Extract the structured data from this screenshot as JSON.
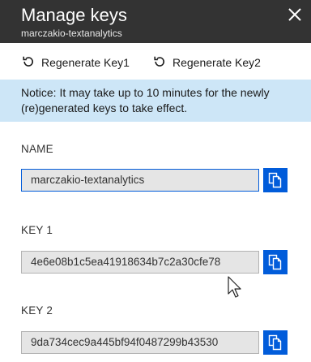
{
  "header": {
    "title": "Manage keys",
    "subtitle": "marczakio-textanalytics"
  },
  "toolbar": {
    "regenerate_key1_label": "Regenerate Key1",
    "regenerate_key2_label": "Regenerate Key2"
  },
  "notice": {
    "text": "Notice: It may take up to 10 minutes for the newly (re)generated keys to take effect."
  },
  "fields": {
    "name": {
      "label": "NAME",
      "value": "marczakio-textanalytics"
    },
    "key1": {
      "label": "KEY 1",
      "value": "4e6e08b1c5ea41918634b7c2a30cfe78"
    },
    "key2": {
      "label": "KEY 2",
      "value": "9da734cec9a445bf94f0487299b43530"
    }
  },
  "icons": {
    "close": "close-icon",
    "regenerate": "refresh-icon",
    "copy": "copy-icon",
    "cursor": "mouse-pointer-icon"
  },
  "colors": {
    "header_bg": "#333333",
    "notice_bg": "#cde6f7",
    "accent": "#015cda"
  }
}
